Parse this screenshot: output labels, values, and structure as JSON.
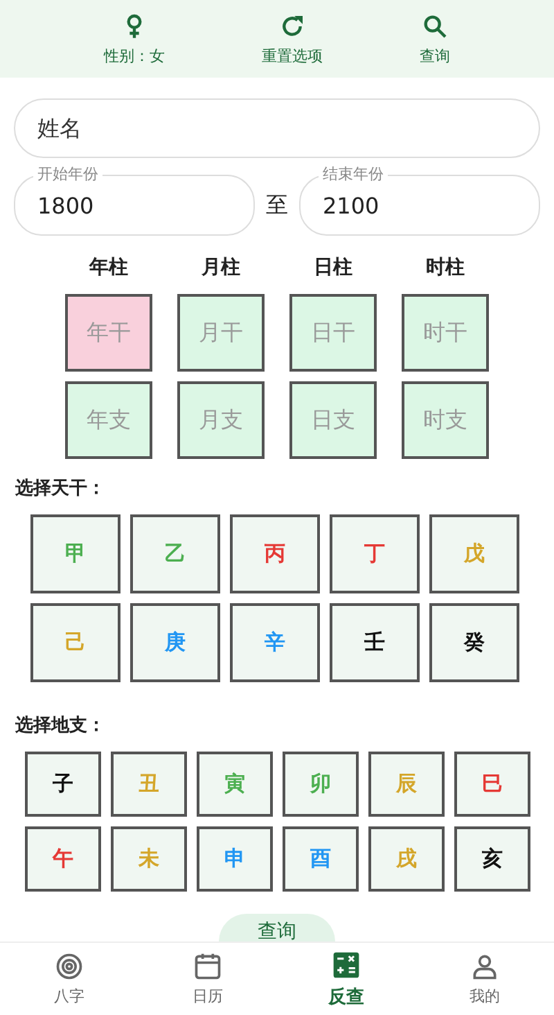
{
  "toolbar": [
    {
      "kind": "gender",
      "label": "性别：女"
    },
    {
      "kind": "reset",
      "label": "重置选项"
    },
    {
      "kind": "search",
      "label": "查询"
    }
  ],
  "name_field": {
    "placeholder": "姓名"
  },
  "year_range": {
    "start": {
      "label": "开始年份",
      "value": "1800"
    },
    "separator": "至",
    "end": {
      "label": "结束年份",
      "value": "2100"
    }
  },
  "pillars": [
    {
      "title": "年柱",
      "stem": {
        "label": "年干",
        "selected": true
      },
      "branch": {
        "label": "年支",
        "selected": false
      }
    },
    {
      "title": "月柱",
      "stem": {
        "label": "月干",
        "selected": false
      },
      "branch": {
        "label": "月支",
        "selected": false
      }
    },
    {
      "title": "日柱",
      "stem": {
        "label": "日干",
        "selected": false
      },
      "branch": {
        "label": "日支",
        "selected": false
      }
    },
    {
      "title": "时柱",
      "stem": {
        "label": "时干",
        "selected": false
      },
      "branch": {
        "label": "时支",
        "selected": false
      }
    }
  ],
  "stems_title": "选择天干：",
  "stems": [
    {
      "label": "甲",
      "color": "#4caf50"
    },
    {
      "label": "乙",
      "color": "#4caf50"
    },
    {
      "label": "丙",
      "color": "#e53935"
    },
    {
      "label": "丁",
      "color": "#e53935"
    },
    {
      "label": "戊",
      "color": "#d4a62a"
    },
    {
      "label": "己",
      "color": "#d4a62a"
    },
    {
      "label": "庚",
      "color": "#2196f3"
    },
    {
      "label": "辛",
      "color": "#2196f3"
    },
    {
      "label": "壬",
      "color": "#111111"
    },
    {
      "label": "癸",
      "color": "#111111"
    }
  ],
  "branches_title": "选择地支：",
  "branches": [
    {
      "label": "子",
      "color": "#111111"
    },
    {
      "label": "丑",
      "color": "#d4a62a"
    },
    {
      "label": "寅",
      "color": "#4caf50"
    },
    {
      "label": "卯",
      "color": "#4caf50"
    },
    {
      "label": "辰",
      "color": "#d4a62a"
    },
    {
      "label": "巳",
      "color": "#e53935"
    },
    {
      "label": "午",
      "color": "#e53935"
    },
    {
      "label": "未",
      "color": "#d4a62a"
    },
    {
      "label": "申",
      "color": "#2196f3"
    },
    {
      "label": "酉",
      "color": "#2196f3"
    },
    {
      "label": "戌",
      "color": "#d4a62a"
    },
    {
      "label": "亥",
      "color": "#111111"
    }
  ],
  "query_button": "查询",
  "nav": [
    {
      "kind": "bazi",
      "label": "八字",
      "selected": false
    },
    {
      "kind": "calendar",
      "label": "日历",
      "selected": false
    },
    {
      "kind": "reverse",
      "label": "反查",
      "selected": true
    },
    {
      "kind": "profile",
      "label": "我的",
      "selected": false
    }
  ]
}
